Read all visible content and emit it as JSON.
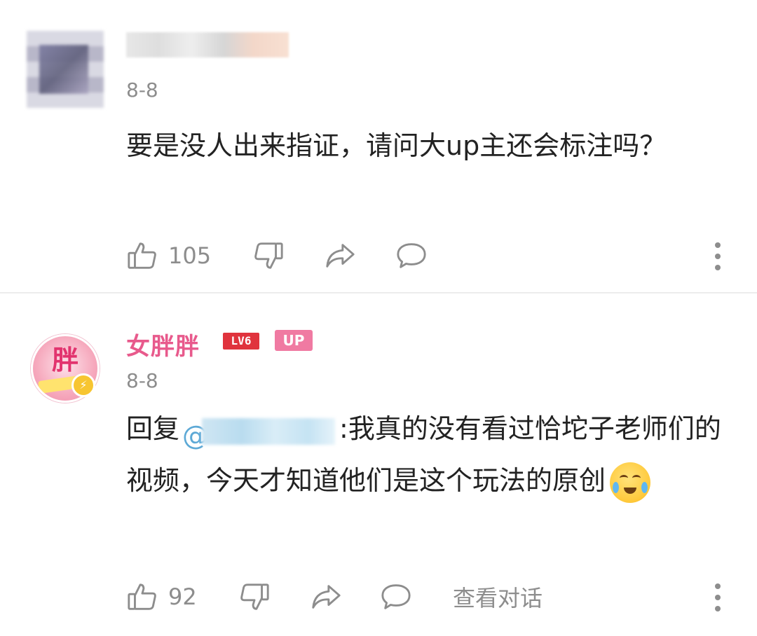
{
  "comments": [
    {
      "date": "8-8",
      "text": "要是没人出来指证，请问大up主还会标注吗？",
      "likes": "105"
    },
    {
      "username": "女胖胖",
      "level_badge": "LV6",
      "up_badge": "UP",
      "date": "8-8",
      "reply_prefix": "回复",
      "mention_at": "@",
      "text_after_mention": ":我真的没有看过恰坨子老师们的视频，今天才知道他们是这个玩法的原创",
      "likes": "92",
      "view_dialog_label": "查看对话"
    }
  ],
  "colors": {
    "username": "#e85a8c",
    "level_badge": "#e0333d",
    "up_badge": "#f07aa2",
    "meta_gray": "#8d8d8d",
    "mention": "#5da9d6"
  },
  "icons": {
    "like": "thumbs-up-icon",
    "dislike": "thumbs-down-icon",
    "share": "share-arrow-icon",
    "reply": "chat-bubble-icon",
    "more": "more-vertical-icon"
  }
}
